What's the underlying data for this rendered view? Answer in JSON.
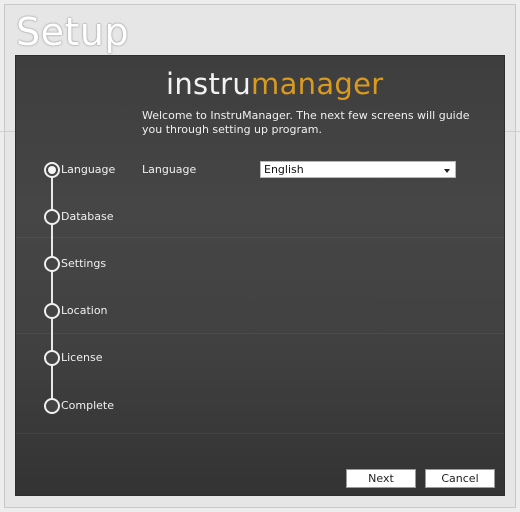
{
  "window": {
    "title": "Setup"
  },
  "logo": {
    "part1": "instru",
    "part2": "manager"
  },
  "welcome_text": "Welcome to InstruManager. The next few screens will guide you through setting up program.",
  "steps": [
    {
      "label": "Language",
      "active": true
    },
    {
      "label": "Database",
      "active": false
    },
    {
      "label": "Settings",
      "active": false
    },
    {
      "label": "Location",
      "active": false
    },
    {
      "label": "License",
      "active": false
    },
    {
      "label": "Complete",
      "active": false
    }
  ],
  "language_field": {
    "label": "Language",
    "value": "English"
  },
  "buttons": {
    "next": "Next",
    "cancel": "Cancel"
  },
  "colors": {
    "accent": "#d99a1e",
    "panel": "#444444"
  },
  "icons": {
    "dropdown": "chevron-down-icon",
    "step_marker": "circle-icon"
  }
}
